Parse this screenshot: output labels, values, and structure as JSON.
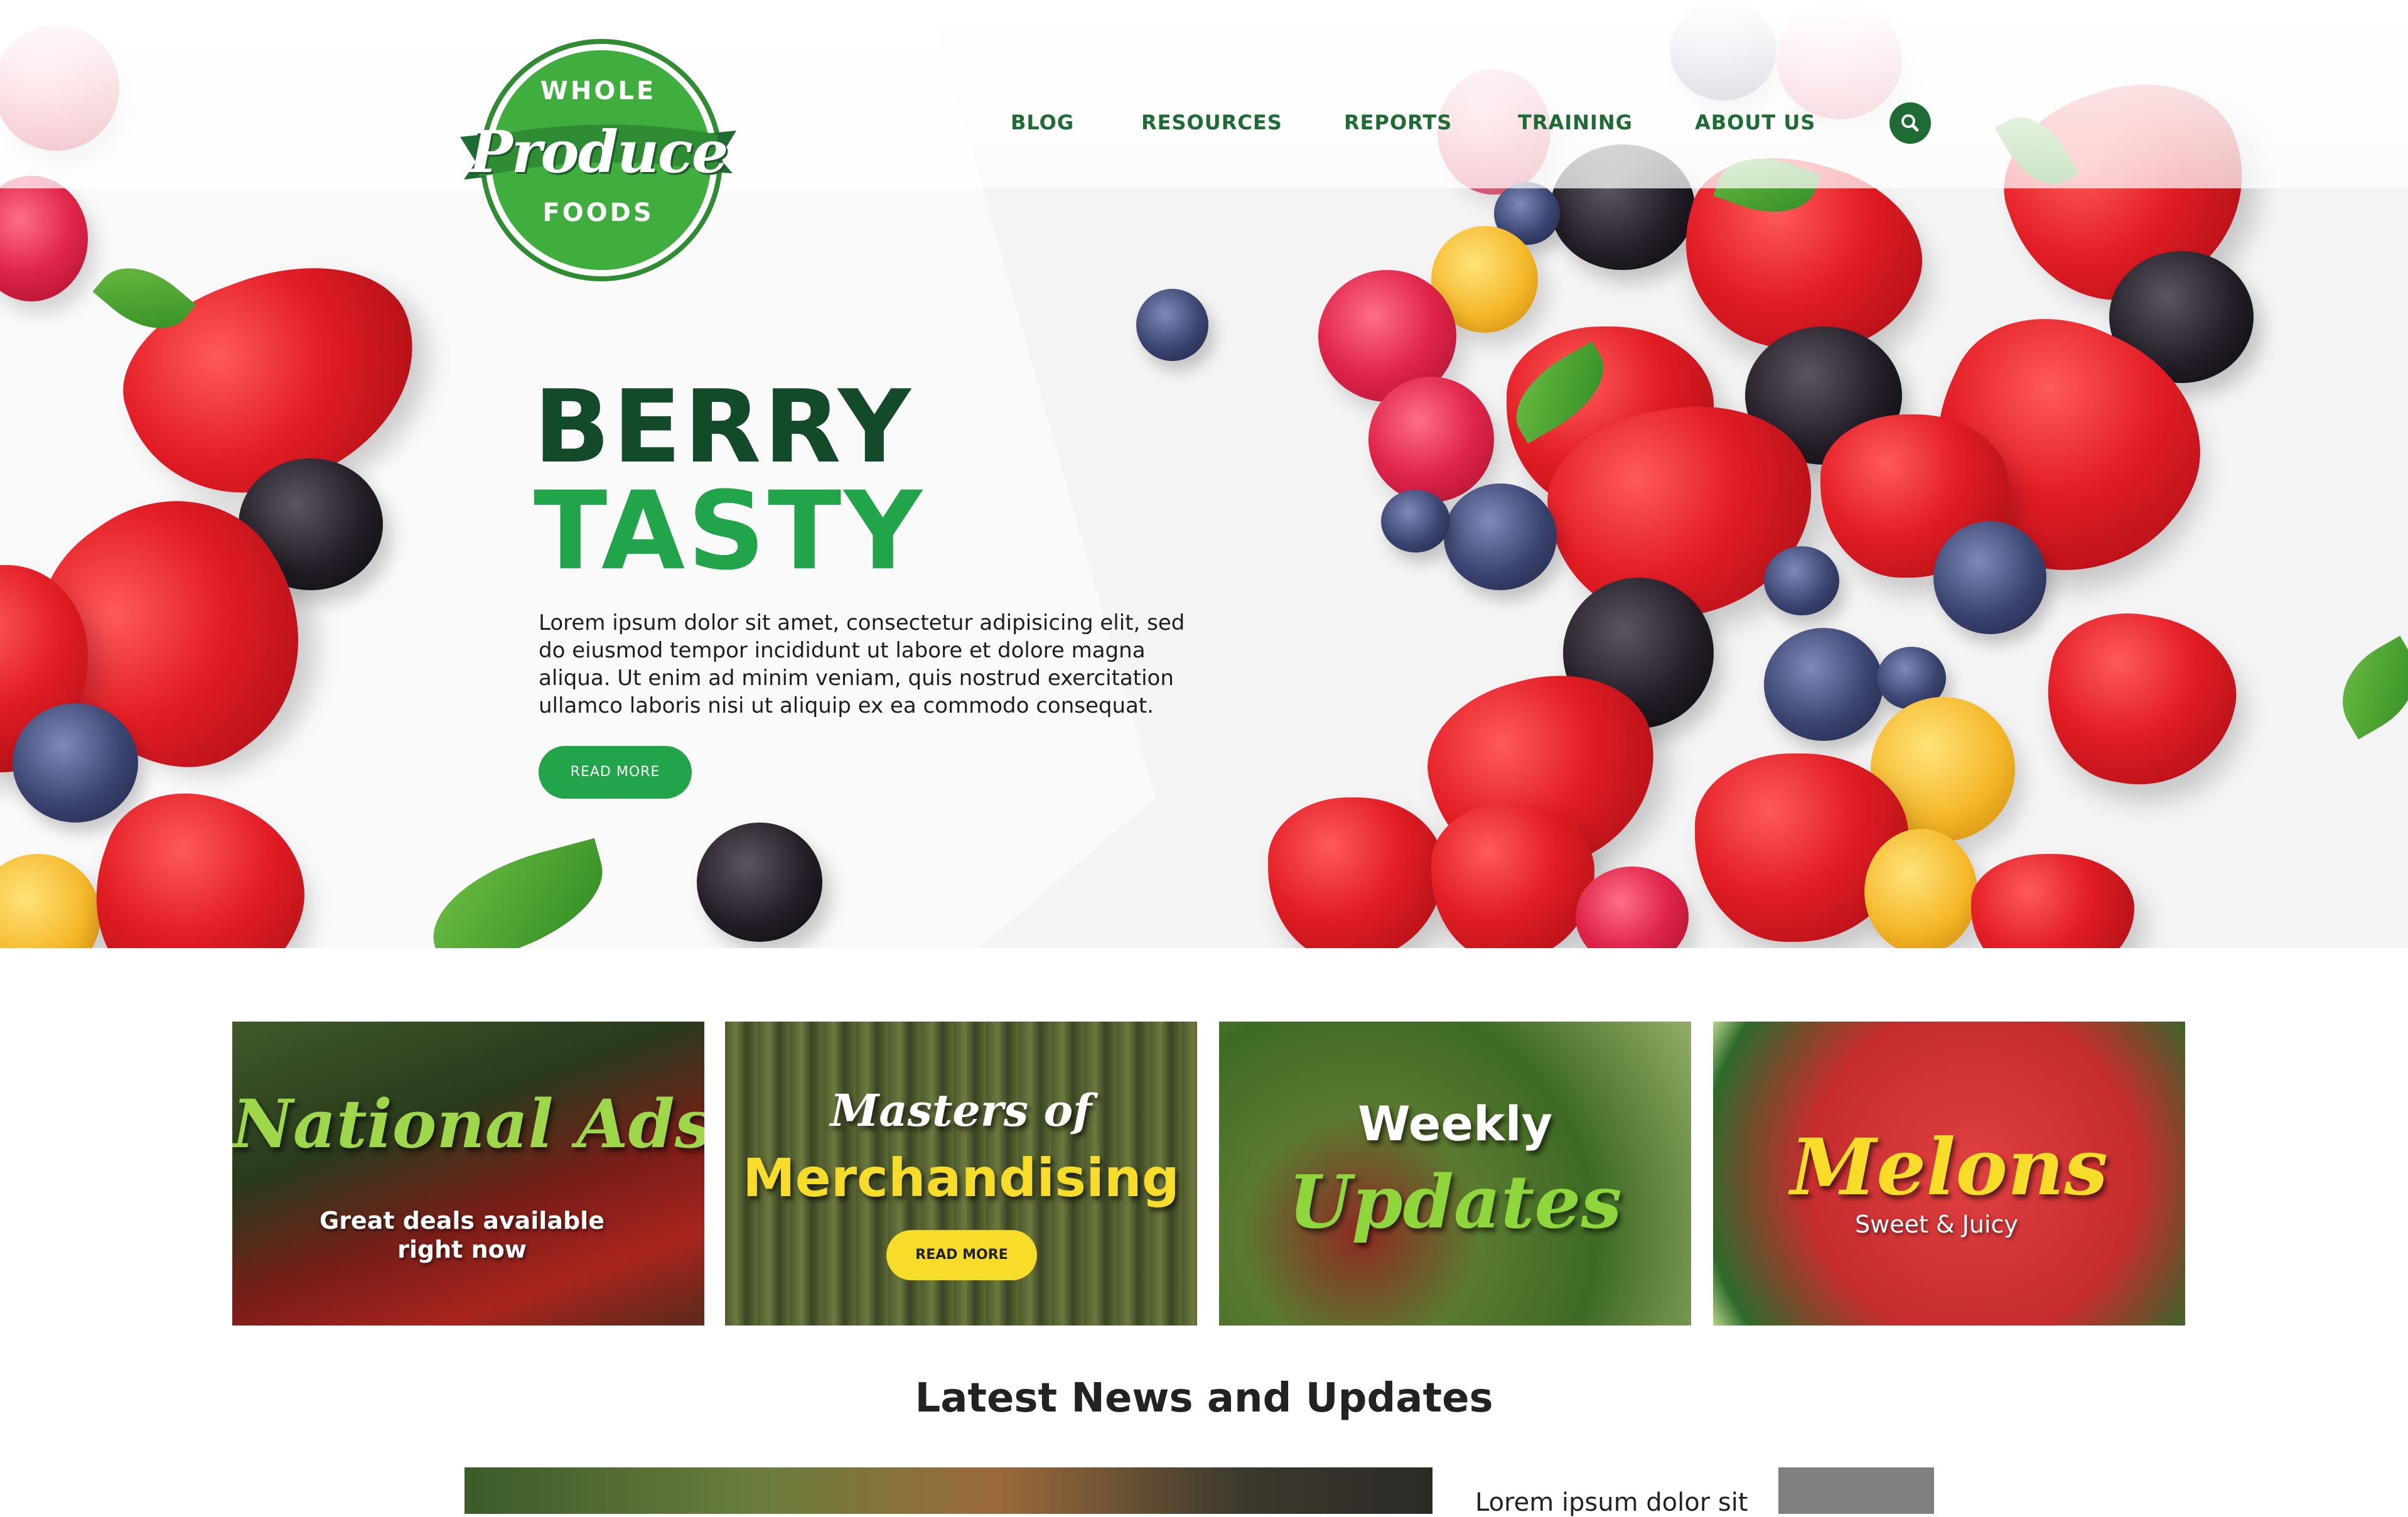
{
  "logo": {
    "top": "WHOLE",
    "script": "Produce",
    "bottom": "FOODS"
  },
  "nav": {
    "items": [
      "BLOG",
      "RESOURCES",
      "REPORTS",
      "TRAINING",
      "ABOUT US"
    ],
    "search_icon": "search-icon"
  },
  "hero": {
    "title_line1": "BERRY",
    "title_line2": "TASTY",
    "body": "Lorem ipsum dolor sit amet, consectetur adipisicing elit, sed do eiusmod tempor incididunt ut labore et dolore magna aliqua. Ut enim ad minim veniam, quis nostrud exercitation ullamco laboris nisi ut aliquip ex ea commodo consequat.",
    "button": "READ MORE"
  },
  "tiles": [
    {
      "title": "National Ads",
      "subtitle_line1": "Great deals available",
      "subtitle_line2": "right now"
    },
    {
      "title_line1": "Masters of",
      "title_line2": "Merchandising",
      "button": "READ MORE"
    },
    {
      "title_line1": "Weekly",
      "title_line2": "Updates"
    },
    {
      "title": "Melons",
      "subtitle": "Sweet & Juicy"
    }
  ],
  "news": {
    "heading": "Latest News and Updates",
    "first_item_text": "Lorem ipsum dolor sit"
  },
  "colors": {
    "dark_green": "#124a2a",
    "green": "#22a54a",
    "nav_green": "#1f6b34",
    "yellow": "#f7dc2a"
  }
}
